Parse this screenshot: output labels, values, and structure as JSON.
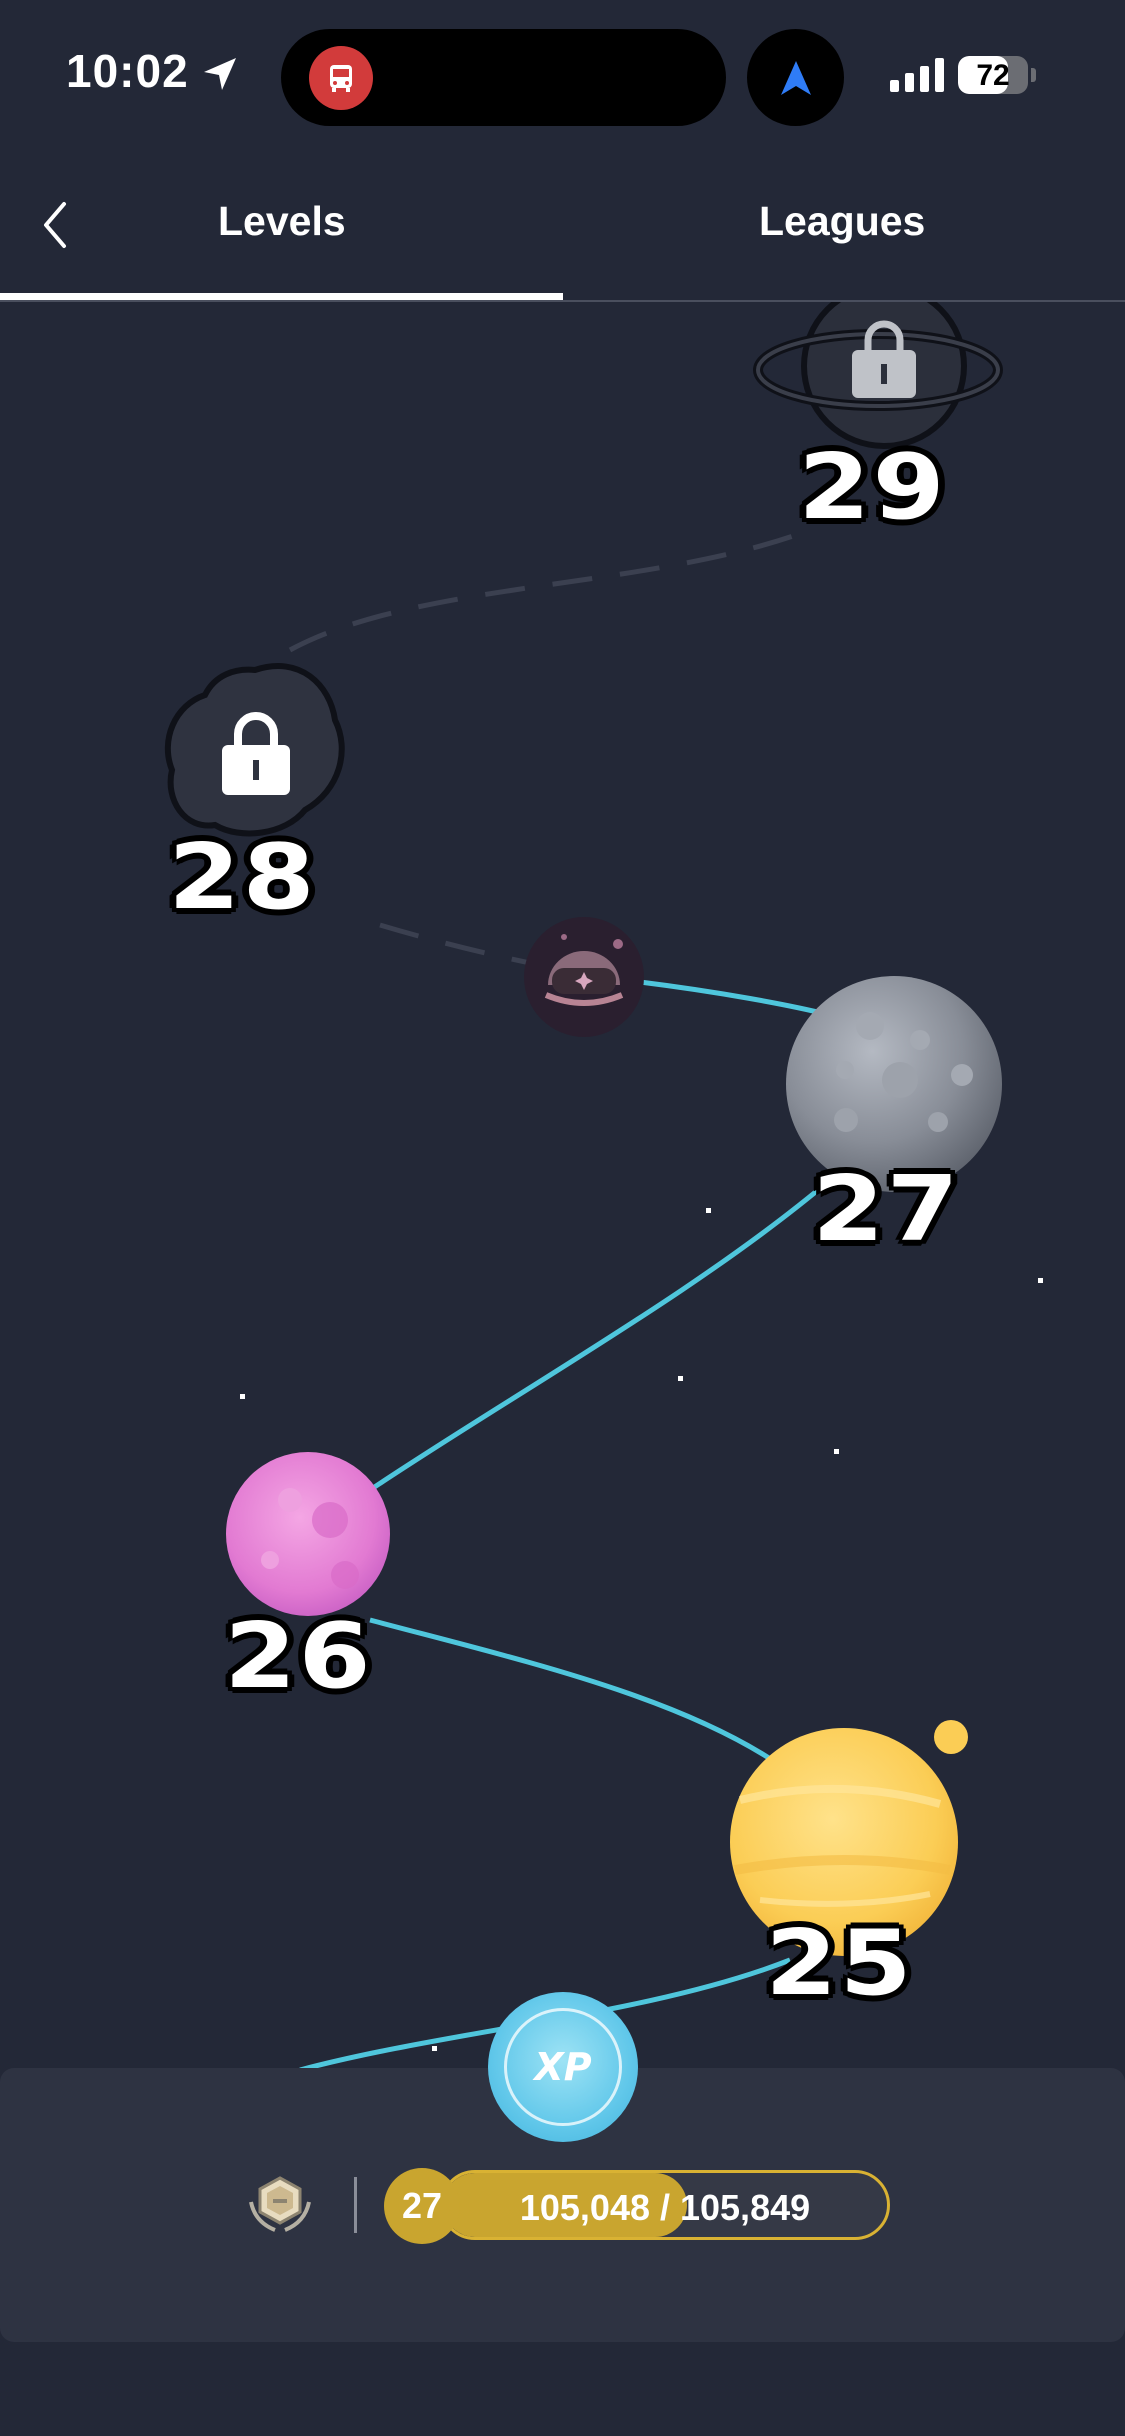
{
  "status_bar": {
    "time": "10:02",
    "battery": "72",
    "battery_level": 0.72
  },
  "tabs": {
    "levels_label": "Levels",
    "leagues_label": "Leagues",
    "active": "Levels"
  },
  "levels": [
    {
      "number": "29",
      "state": "locked",
      "planet": "ringed-planet"
    },
    {
      "number": "28",
      "state": "locked",
      "planet": "cloud-planet"
    },
    {
      "number": "27",
      "state": "current",
      "planet": "gray-moon"
    },
    {
      "number": "26",
      "state": "completed",
      "planet": "pink-planet"
    },
    {
      "number": "25",
      "state": "completed",
      "planet": "yellow-planet"
    }
  ],
  "bottom": {
    "xp_label": "XP",
    "level": "27",
    "progress_text": "105,048 / 105,849",
    "progress_fraction": 0.55
  },
  "colors": {
    "background": "#232837",
    "path": "#4fc6dc",
    "gold": "#c9a52f",
    "xp": "#62c8ea"
  }
}
